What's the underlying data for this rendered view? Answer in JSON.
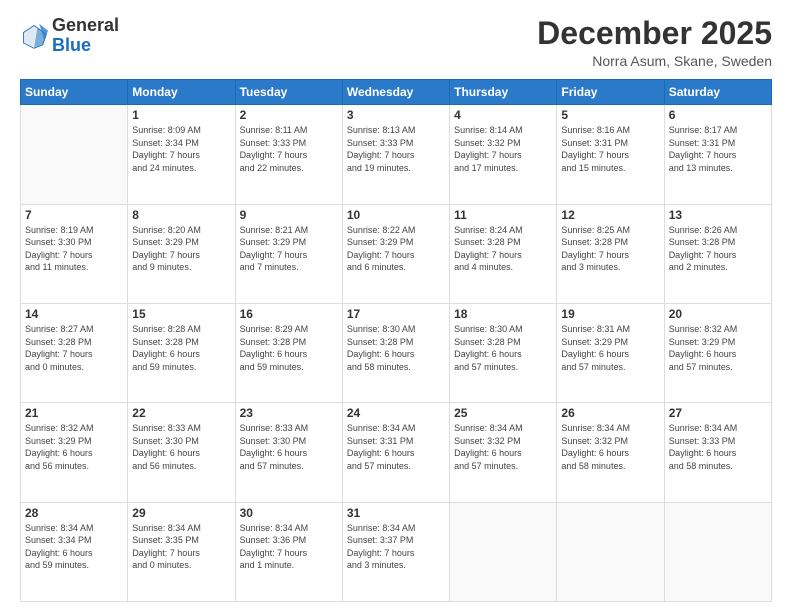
{
  "header": {
    "logo_general": "General",
    "logo_blue": "Blue",
    "title": "December 2025",
    "location": "Norra Asum, Skane, Sweden"
  },
  "days_of_week": [
    "Sunday",
    "Monday",
    "Tuesday",
    "Wednesday",
    "Thursday",
    "Friday",
    "Saturday"
  ],
  "weeks": [
    [
      {
        "day": "",
        "info": ""
      },
      {
        "day": "1",
        "info": "Sunrise: 8:09 AM\nSunset: 3:34 PM\nDaylight: 7 hours\nand 24 minutes."
      },
      {
        "day": "2",
        "info": "Sunrise: 8:11 AM\nSunset: 3:33 PM\nDaylight: 7 hours\nand 22 minutes."
      },
      {
        "day": "3",
        "info": "Sunrise: 8:13 AM\nSunset: 3:33 PM\nDaylight: 7 hours\nand 19 minutes."
      },
      {
        "day": "4",
        "info": "Sunrise: 8:14 AM\nSunset: 3:32 PM\nDaylight: 7 hours\nand 17 minutes."
      },
      {
        "day": "5",
        "info": "Sunrise: 8:16 AM\nSunset: 3:31 PM\nDaylight: 7 hours\nand 15 minutes."
      },
      {
        "day": "6",
        "info": "Sunrise: 8:17 AM\nSunset: 3:31 PM\nDaylight: 7 hours\nand 13 minutes."
      }
    ],
    [
      {
        "day": "7",
        "info": "Sunrise: 8:19 AM\nSunset: 3:30 PM\nDaylight: 7 hours\nand 11 minutes."
      },
      {
        "day": "8",
        "info": "Sunrise: 8:20 AM\nSunset: 3:29 PM\nDaylight: 7 hours\nand 9 minutes."
      },
      {
        "day": "9",
        "info": "Sunrise: 8:21 AM\nSunset: 3:29 PM\nDaylight: 7 hours\nand 7 minutes."
      },
      {
        "day": "10",
        "info": "Sunrise: 8:22 AM\nSunset: 3:29 PM\nDaylight: 7 hours\nand 6 minutes."
      },
      {
        "day": "11",
        "info": "Sunrise: 8:24 AM\nSunset: 3:28 PM\nDaylight: 7 hours\nand 4 minutes."
      },
      {
        "day": "12",
        "info": "Sunrise: 8:25 AM\nSunset: 3:28 PM\nDaylight: 7 hours\nand 3 minutes."
      },
      {
        "day": "13",
        "info": "Sunrise: 8:26 AM\nSunset: 3:28 PM\nDaylight: 7 hours\nand 2 minutes."
      }
    ],
    [
      {
        "day": "14",
        "info": "Sunrise: 8:27 AM\nSunset: 3:28 PM\nDaylight: 7 hours\nand 0 minutes."
      },
      {
        "day": "15",
        "info": "Sunrise: 8:28 AM\nSunset: 3:28 PM\nDaylight: 6 hours\nand 59 minutes."
      },
      {
        "day": "16",
        "info": "Sunrise: 8:29 AM\nSunset: 3:28 PM\nDaylight: 6 hours\nand 59 minutes."
      },
      {
        "day": "17",
        "info": "Sunrise: 8:30 AM\nSunset: 3:28 PM\nDaylight: 6 hours\nand 58 minutes."
      },
      {
        "day": "18",
        "info": "Sunrise: 8:30 AM\nSunset: 3:28 PM\nDaylight: 6 hours\nand 57 minutes."
      },
      {
        "day": "19",
        "info": "Sunrise: 8:31 AM\nSunset: 3:29 PM\nDaylight: 6 hours\nand 57 minutes."
      },
      {
        "day": "20",
        "info": "Sunrise: 8:32 AM\nSunset: 3:29 PM\nDaylight: 6 hours\nand 57 minutes."
      }
    ],
    [
      {
        "day": "21",
        "info": "Sunrise: 8:32 AM\nSunset: 3:29 PM\nDaylight: 6 hours\nand 56 minutes."
      },
      {
        "day": "22",
        "info": "Sunrise: 8:33 AM\nSunset: 3:30 PM\nDaylight: 6 hours\nand 56 minutes."
      },
      {
        "day": "23",
        "info": "Sunrise: 8:33 AM\nSunset: 3:30 PM\nDaylight: 6 hours\nand 57 minutes."
      },
      {
        "day": "24",
        "info": "Sunrise: 8:34 AM\nSunset: 3:31 PM\nDaylight: 6 hours\nand 57 minutes."
      },
      {
        "day": "25",
        "info": "Sunrise: 8:34 AM\nSunset: 3:32 PM\nDaylight: 6 hours\nand 57 minutes."
      },
      {
        "day": "26",
        "info": "Sunrise: 8:34 AM\nSunset: 3:32 PM\nDaylight: 6 hours\nand 58 minutes."
      },
      {
        "day": "27",
        "info": "Sunrise: 8:34 AM\nSunset: 3:33 PM\nDaylight: 6 hours\nand 58 minutes."
      }
    ],
    [
      {
        "day": "28",
        "info": "Sunrise: 8:34 AM\nSunset: 3:34 PM\nDaylight: 6 hours\nand 59 minutes."
      },
      {
        "day": "29",
        "info": "Sunrise: 8:34 AM\nSunset: 3:35 PM\nDaylight: 7 hours\nand 0 minutes."
      },
      {
        "day": "30",
        "info": "Sunrise: 8:34 AM\nSunset: 3:36 PM\nDaylight: 7 hours\nand 1 minute."
      },
      {
        "day": "31",
        "info": "Sunrise: 8:34 AM\nSunset: 3:37 PM\nDaylight: 7 hours\nand 3 minutes."
      },
      {
        "day": "",
        "info": ""
      },
      {
        "day": "",
        "info": ""
      },
      {
        "day": "",
        "info": ""
      }
    ]
  ]
}
